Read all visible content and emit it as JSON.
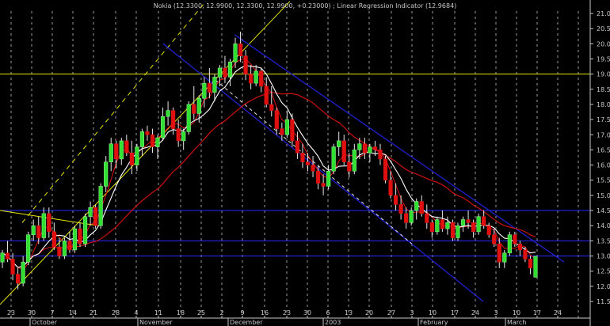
{
  "chart_data": {
    "type": "candlestick",
    "title": "Nokia (12.3300, 12.9900, 12.3300, 12.9900, +0.23000) ; Linear Regression Indicator (12.9684)",
    "ylim": [
      11.4,
      21.4
    ],
    "ytick_labels": [
      "21.0",
      "20.5",
      "20.0",
      "19.5",
      "19.0",
      "18.5",
      "18.0",
      "17.5",
      "17.0",
      "16.5",
      "16.0",
      "15.5",
      "15.0",
      "14.5",
      "14.0",
      "13.5",
      "13.0",
      "12.5",
      "12.0",
      "11.5"
    ],
    "ytick_values": [
      21.0,
      20.5,
      20.0,
      19.5,
      19.0,
      18.5,
      18.0,
      17.5,
      17.0,
      16.5,
      16.0,
      15.5,
      15.0,
      14.5,
      14.0,
      13.5,
      13.0,
      12.5,
      12.0,
      11.5
    ],
    "xtick_labels": [
      "23",
      "30",
      "7",
      "14",
      "21",
      "28",
      "4",
      "11",
      "18",
      "25",
      "2",
      "9",
      "16",
      "23",
      "30",
      "6",
      "13",
      "20",
      "27",
      "3",
      "10",
      "17",
      "24",
      "3",
      "10",
      "17",
      "24"
    ],
    "month_labels": [
      "October",
      "November",
      "December",
      "2003",
      "February",
      "March"
    ],
    "horizontal_levels": [
      {
        "value": 19.0,
        "color": "#e6e600"
      },
      {
        "value": 14.5,
        "color": "#2828ff"
      },
      {
        "value": 13.5,
        "color": "#2828ff"
      },
      {
        "value": 13.0,
        "color": "#2828ff"
      }
    ],
    "colors": {
      "up": "#30e030",
      "down": "#e01010",
      "wick": "#e8e8e8",
      "ma_short": "#ffffff",
      "ma_mid": "#e01010",
      "ma_long": "#cc1010",
      "channel": "#2020d0",
      "uptrend": "#e6e600",
      "background": "#000000",
      "grid": "#d0d0d0"
    },
    "candles": [
      [
        12.8,
        13.2,
        12.6,
        13.1
      ],
      [
        13.1,
        13.5,
        12.8,
        12.9
      ],
      [
        12.9,
        13.1,
        12.2,
        12.4
      ],
      [
        12.4,
        12.6,
        11.9,
        12.1
      ],
      [
        12.1,
        13.0,
        12.0,
        12.8
      ],
      [
        12.8,
        13.8,
        12.7,
        13.7
      ],
      [
        13.7,
        14.2,
        13.5,
        14.0
      ],
      [
        14.0,
        14.3,
        13.4,
        13.6
      ],
      [
        13.6,
        14.6,
        13.5,
        14.4
      ],
      [
        14.4,
        14.6,
        13.6,
        13.8
      ],
      [
        13.8,
        14.1,
        13.2,
        13.3
      ],
      [
        13.3,
        13.6,
        12.9,
        13.0
      ],
      [
        13.0,
        13.6,
        12.9,
        13.5
      ],
      [
        13.5,
        13.8,
        13.1,
        13.2
      ],
      [
        13.2,
        14.0,
        13.1,
        13.9
      ],
      [
        13.9,
        14.1,
        13.3,
        13.4
      ],
      [
        13.4,
        14.4,
        13.3,
        14.3
      ],
      [
        14.3,
        14.8,
        14.0,
        14.6
      ],
      [
        14.6,
        14.7,
        13.9,
        14.0
      ],
      [
        14.0,
        15.4,
        13.9,
        15.3
      ],
      [
        15.3,
        16.3,
        15.1,
        16.1
      ],
      [
        16.1,
        16.9,
        15.8,
        16.7
      ],
      [
        16.7,
        16.8,
        15.9,
        16.2
      ],
      [
        16.2,
        16.9,
        16.0,
        16.8
      ],
      [
        16.8,
        17.0,
        16.3,
        16.4
      ],
      [
        16.4,
        16.8,
        15.7,
        16.0
      ],
      [
        16.0,
        16.7,
        15.8,
        16.6
      ],
      [
        16.6,
        17.2,
        16.3,
        17.1
      ],
      [
        17.1,
        17.3,
        16.8,
        17.0
      ],
      [
        17.0,
        17.2,
        16.4,
        16.6
      ],
      [
        16.6,
        17.0,
        16.2,
        16.9
      ],
      [
        16.9,
        17.9,
        16.8,
        17.6
      ],
      [
        17.6,
        18.1,
        17.3,
        17.8
      ],
      [
        17.8,
        17.9,
        17.0,
        17.2
      ],
      [
        17.2,
        17.5,
        16.6,
        16.8
      ],
      [
        16.8,
        17.2,
        16.5,
        17.1
      ],
      [
        17.1,
        18.1,
        17.0,
        18.0
      ],
      [
        18.0,
        18.6,
        17.5,
        17.7
      ],
      [
        17.7,
        18.3,
        17.4,
        18.2
      ],
      [
        18.2,
        18.9,
        17.9,
        18.7
      ],
      [
        18.7,
        19.2,
        18.2,
        18.4
      ],
      [
        18.4,
        19.0,
        18.1,
        18.9
      ],
      [
        18.9,
        19.3,
        18.6,
        19.2
      ],
      [
        19.2,
        19.6,
        18.7,
        18.9
      ],
      [
        18.9,
        19.5,
        18.6,
        19.4
      ],
      [
        19.4,
        20.2,
        19.2,
        20.0
      ],
      [
        20.0,
        20.4,
        19.4,
        19.6
      ],
      [
        19.6,
        19.8,
        18.8,
        19.0
      ],
      [
        19.0,
        19.3,
        18.5,
        18.7
      ],
      [
        18.7,
        19.3,
        18.6,
        19.1
      ],
      [
        19.1,
        19.2,
        18.4,
        18.6
      ],
      [
        18.6,
        18.9,
        17.9,
        18.0
      ],
      [
        18.0,
        18.6,
        17.6,
        17.8
      ],
      [
        17.8,
        17.9,
        17.0,
        17.2
      ],
      [
        17.2,
        17.4,
        16.8,
        17.0
      ],
      [
        17.0,
        17.8,
        16.9,
        17.5
      ],
      [
        17.5,
        17.7,
        16.6,
        16.8
      ],
      [
        16.8,
        17.1,
        16.2,
        16.4
      ],
      [
        16.4,
        16.7,
        15.9,
        16.1
      ],
      [
        16.1,
        16.4,
        15.8,
        16.0
      ],
      [
        16.0,
        16.3,
        15.6,
        15.8
      ],
      [
        15.8,
        16.0,
        15.2,
        15.4
      ],
      [
        15.4,
        15.7,
        15.0,
        15.3
      ],
      [
        15.3,
        16.0,
        15.2,
        15.8
      ],
      [
        15.8,
        16.7,
        15.7,
        16.6
      ],
      [
        16.6,
        17.1,
        16.3,
        16.8
      ],
      [
        16.8,
        17.0,
        16.0,
        16.1
      ],
      [
        16.1,
        16.4,
        15.6,
        15.8
      ],
      [
        15.8,
        16.7,
        15.7,
        16.5
      ],
      [
        16.5,
        16.9,
        16.2,
        16.7
      ],
      [
        16.7,
        16.9,
        16.2,
        16.4
      ],
      [
        16.4,
        16.7,
        16.1,
        16.6
      ],
      [
        16.6,
        16.8,
        16.3,
        16.5
      ],
      [
        16.5,
        16.7,
        16.0,
        16.2
      ],
      [
        16.2,
        16.3,
        15.4,
        15.5
      ],
      [
        15.5,
        15.8,
        14.9,
        15.0
      ],
      [
        15.0,
        15.4,
        14.5,
        14.7
      ],
      [
        14.7,
        15.0,
        14.2,
        14.4
      ],
      [
        14.4,
        14.6,
        13.9,
        14.1
      ],
      [
        14.1,
        14.6,
        14.0,
        14.5
      ],
      [
        14.5,
        14.9,
        14.2,
        14.8
      ],
      [
        14.8,
        15.0,
        14.3,
        14.4
      ],
      [
        14.4,
        14.7,
        13.9,
        14.1
      ],
      [
        14.1,
        14.2,
        13.6,
        13.8
      ],
      [
        13.8,
        14.3,
        13.7,
        14.2
      ],
      [
        14.2,
        14.5,
        13.8,
        13.9
      ],
      [
        13.9,
        14.3,
        13.7,
        14.1
      ],
      [
        14.1,
        14.2,
        13.5,
        13.6
      ],
      [
        13.6,
        14.1,
        13.5,
        14.0
      ],
      [
        14.0,
        14.3,
        13.8,
        14.2
      ],
      [
        14.2,
        14.5,
        13.9,
        14.1
      ],
      [
        14.1,
        14.2,
        13.6,
        13.8
      ],
      [
        13.8,
        14.4,
        13.7,
        14.3
      ],
      [
        14.3,
        14.5,
        13.9,
        14.0
      ],
      [
        14.0,
        14.1,
        13.6,
        13.7
      ],
      [
        13.7,
        13.9,
        13.3,
        13.4
      ],
      [
        13.4,
        13.6,
        12.6,
        12.8
      ],
      [
        12.8,
        13.2,
        12.6,
        13.1
      ],
      [
        13.1,
        13.8,
        13.0,
        13.7
      ],
      [
        13.7,
        13.8,
        13.3,
        13.4
      ],
      [
        13.4,
        13.5,
        13.0,
        13.2
      ],
      [
        13.2,
        13.3,
        12.8,
        12.9
      ],
      [
        12.9,
        13.0,
        12.4,
        12.6
      ],
      [
        12.3,
        13.0,
        12.3,
        12.99
      ]
    ]
  }
}
